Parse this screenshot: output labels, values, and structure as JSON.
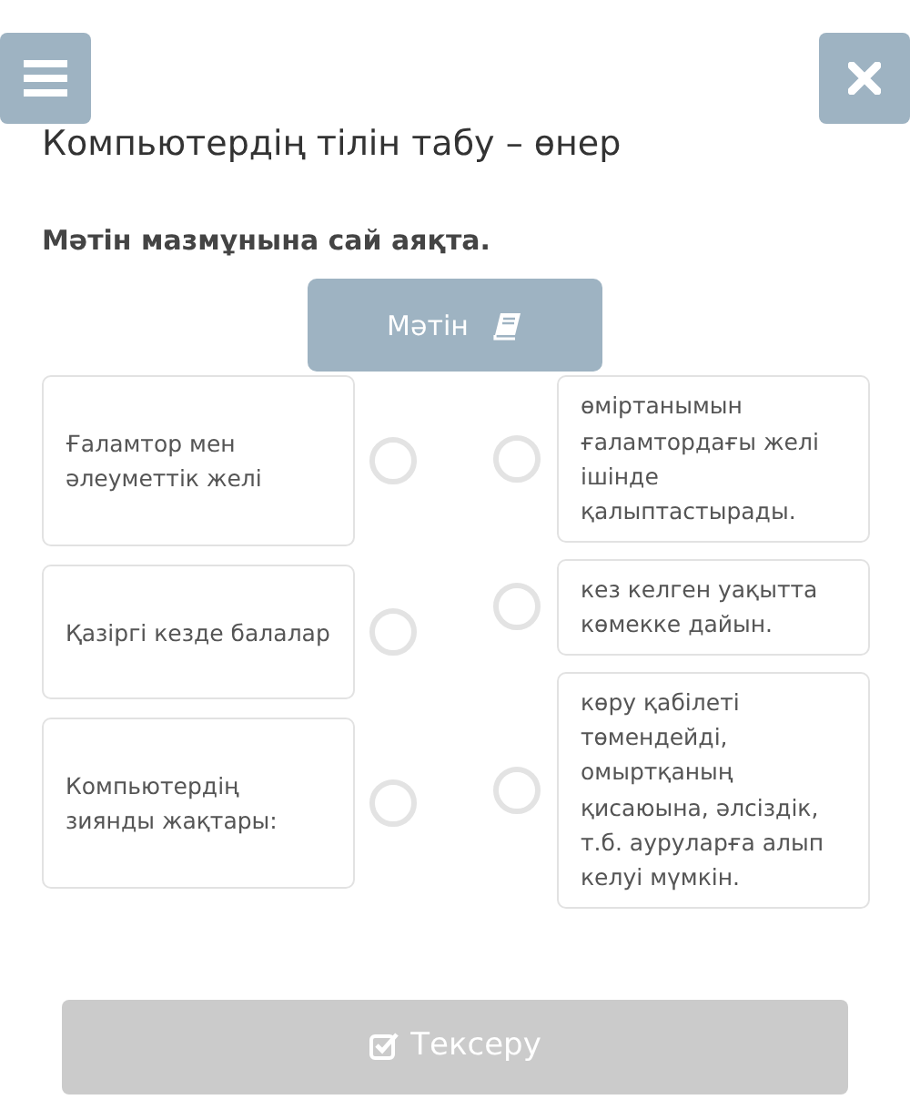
{
  "title": "Компьютердің тілін табу – өнер",
  "instruction": "Мәтін мазмұнына сай аяқта.",
  "text_button": {
    "label": "Мәтін"
  },
  "left_items": [
    {
      "text": "Ғаламтор мен әлеуметтік желі"
    },
    {
      "text": "Қазіргі кезде балалар"
    },
    {
      "text": "Компьютердің зиянды жақтары:"
    }
  ],
  "right_items": [
    {
      "text": "өміртанымын ғаламтордағы желі ішінде қалыптастырады."
    },
    {
      "text": "кез келген уақытта көмекке дайын."
    },
    {
      "text": "көру қабілеті төмендейді, омыртқаның қисаюына, әлсіздік, т.б. ауруларға алып келуі мүмкін."
    }
  ],
  "check_button": {
    "label": "Тексеру",
    "disabled": true
  }
}
